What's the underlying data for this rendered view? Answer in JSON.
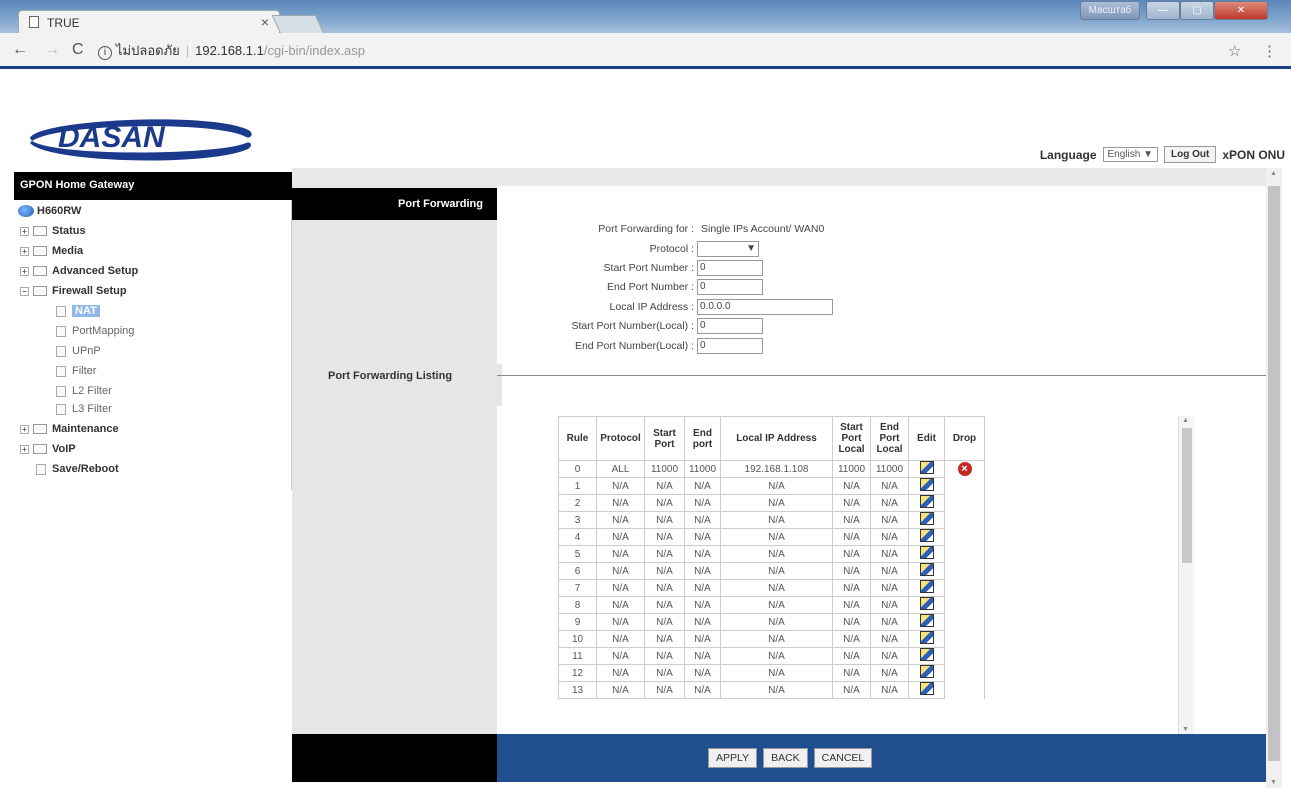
{
  "browser": {
    "tab_title": "TRUE",
    "tab_close": "×",
    "window_label": "Масштаб",
    "nav_back": "←",
    "nav_forward": "→",
    "nav_reload": "C",
    "info_icon": "ⓘ",
    "security_text": "ไม่ปลอดภัย",
    "url_host": "192.168.1.1",
    "url_path": "/cgi-bin/index.asp",
    "star": "☆",
    "menu": "⋮"
  },
  "header": {
    "logo_text": "DASAN",
    "language_label": "Language",
    "language_value": "English ▼",
    "logout_label": "Log Out",
    "product": "xPON ONU"
  },
  "tree": {
    "title": "GPON Home Gateway",
    "root": "H660RW",
    "items": [
      {
        "label": "Status"
      },
      {
        "label": "Media"
      },
      {
        "label": "Advanced Setup"
      },
      {
        "label": "Firewall Setup"
      },
      {
        "label": "NAT"
      },
      {
        "label": "PortMapping"
      },
      {
        "label": "UPnP"
      },
      {
        "label": "Filter"
      },
      {
        "label": "L2 Filter"
      },
      {
        "label": "L3 Filter"
      },
      {
        "label": "Maintenance"
      },
      {
        "label": "VoIP"
      },
      {
        "label": "Save/Reboot"
      }
    ]
  },
  "content": {
    "port_forwarding_label": "Port Forwarding",
    "listing_label": "Port Forwarding Listing",
    "form": {
      "for_label": "Port Forwarding for :",
      "for_value": "Single IPs Account/ WAN0",
      "protocol_label": "Protocol :",
      "protocol_value": "",
      "start_port_label": "Start Port Number :",
      "start_port_value": "0",
      "end_port_label": "End Port Number :",
      "end_port_value": "0",
      "local_ip_label": "Local IP Address :",
      "local_ip_value": "0.0.0.0",
      "start_local_label": "Start Port Number(Local) :",
      "start_local_value": "0",
      "end_local_label": "End Port Number(Local) :",
      "end_local_value": "0"
    },
    "table": {
      "headers": [
        "Rule",
        "Protocol",
        "Start Port",
        "End port",
        "Local IP Address",
        "Start Port Local",
        "End Port Local",
        "Edit",
        "Drop"
      ],
      "rows": [
        [
          "0",
          "ALL",
          "11000",
          "11000",
          "192.168.1.108",
          "11000",
          "11000"
        ],
        [
          "1",
          "N/A",
          "N/A",
          "N/A",
          "N/A",
          "N/A",
          "N/A"
        ],
        [
          "2",
          "N/A",
          "N/A",
          "N/A",
          "N/A",
          "N/A",
          "N/A"
        ],
        [
          "3",
          "N/A",
          "N/A",
          "N/A",
          "N/A",
          "N/A",
          "N/A"
        ],
        [
          "4",
          "N/A",
          "N/A",
          "N/A",
          "N/A",
          "N/A",
          "N/A"
        ],
        [
          "5",
          "N/A",
          "N/A",
          "N/A",
          "N/A",
          "N/A",
          "N/A"
        ],
        [
          "6",
          "N/A",
          "N/A",
          "N/A",
          "N/A",
          "N/A",
          "N/A"
        ],
        [
          "7",
          "N/A",
          "N/A",
          "N/A",
          "N/A",
          "N/A",
          "N/A"
        ],
        [
          "8",
          "N/A",
          "N/A",
          "N/A",
          "N/A",
          "N/A",
          "N/A"
        ],
        [
          "9",
          "N/A",
          "N/A",
          "N/A",
          "N/A",
          "N/A",
          "N/A"
        ],
        [
          "10",
          "N/A",
          "N/A",
          "N/A",
          "N/A",
          "N/A",
          "N/A"
        ],
        [
          "11",
          "N/A",
          "N/A",
          "N/A",
          "N/A",
          "N/A",
          "N/A"
        ],
        [
          "12",
          "N/A",
          "N/A",
          "N/A",
          "N/A",
          "N/A",
          "N/A"
        ],
        [
          "13",
          "N/A",
          "N/A",
          "N/A",
          "N/A",
          "N/A",
          "N/A"
        ]
      ]
    },
    "buttons": {
      "apply": "APPLY",
      "back": "BACK",
      "cancel": "CANCEL"
    }
  },
  "colors": {
    "logo_blue": "#1b3a8c",
    "bottom_bar": "#1f4f8f",
    "nat_highlight": "#8fb8e8"
  }
}
